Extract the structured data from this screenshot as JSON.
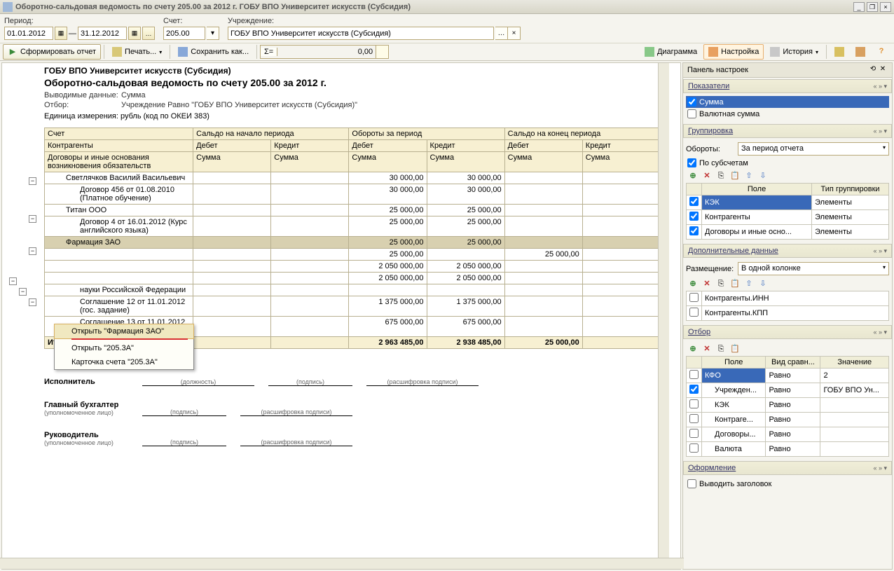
{
  "window_title": "Оборотно-сальдовая ведомость по счету 205.00 за 2012 г. ГОБУ ВПО Университет искусств (Субсидия)",
  "params": {
    "period_label": "Период:",
    "date_from": "01.01.2012",
    "date_to": "31.12.2012",
    "dash": "—",
    "account_label": "Счет:",
    "account": "205.00",
    "org_label": "Учреждение:",
    "org": "ГОБУ ВПО Университет искусств (Субсидия)"
  },
  "toolbar": {
    "run": "Сформировать отчет",
    "print": "Печать...",
    "save": "Сохранить как...",
    "sigma": "Σ=",
    "sigma_val": "0,00",
    "diagram": "Диаграмма",
    "settings": "Настройка",
    "history": "История"
  },
  "report": {
    "org": "ГОБУ ВПО Университет искусств (Субсидия)",
    "title": "Оборотно-сальдовая ведомость по счету 205.00 за 2012 г.",
    "out_lbl": "Выводимые данные:",
    "out_val": "Сумма",
    "filter_lbl": "Отбор:",
    "filter_val": "Учреждение Равно \"ГОБУ ВПО Университет искусств (Субсидия)\"",
    "unit": "Единица измерения: рубль (код по ОКЕИ 383)",
    "h": {
      "acct": "Счет",
      "kontr": "Контрагенты",
      "dogov": "Договоры и иные основания возникновения обязательств",
      "beg": "Сальдо на начало периода",
      "turn": "Обороты за период",
      "end": "Сальдо на конец периода",
      "debit": "Дебет",
      "credit": "Кредит",
      "sum": "Сумма"
    },
    "rows": [
      {
        "t": "agent",
        "lbl": "Светлячков Василий Васильевич",
        "td": "30 000,00",
        "tk": "30 000,00"
      },
      {
        "t": "dogov",
        "lbl": "Договор 456 от 01.08.2010 (Платное обучение)",
        "td": "30 000,00",
        "tk": "30 000,00"
      },
      {
        "t": "agent",
        "lbl": "Титан ООО",
        "td": "25 000,00",
        "tk": "25 000,00"
      },
      {
        "t": "dogov",
        "lbl": "Договор 4 от 16.01.2012 (Курс английского языка)",
        "td": "25 000,00",
        "tk": "25 000,00"
      },
      {
        "t": "agent",
        "lbl": "Фармация ЗАО",
        "td": "25 000,00",
        "tk": "25 000,00",
        "sel": true
      },
      {
        "t": "dogov",
        "lbl": "",
        "td": "25 000,00",
        "ed": "25 000,00"
      },
      {
        "t": "agent",
        "lbl": "",
        "td": "2 050 000,00",
        "tk": "2 050 000,00"
      },
      {
        "t": "dogov",
        "lbl": "",
        "td": "2 050 000,00",
        "tk": "2 050 000,00"
      },
      {
        "t": "dogov",
        "lbl": "науки Российской Федерации",
        "td": "",
        "tk": ""
      },
      {
        "t": "dogov",
        "lbl": "Соглашение 12 от 11.01.2012 (гос. задание)",
        "td": "1 375 000,00",
        "tk": "1 375 000,00"
      },
      {
        "t": "dogov",
        "lbl": "Соглашение 13 от 11.01.2012 (Стипендия)",
        "td": "675 000,00",
        "tk": "675 000,00"
      }
    ],
    "total_lbl": "Итого",
    "total": {
      "td": "2 963 485,00",
      "tk": "2 938 485,00",
      "ed": "25 000,00"
    }
  },
  "ctx": {
    "open1": "Открыть \"Фармация ЗАО\"",
    "open2": "Открыть \"205.3А\"",
    "card": "Карточка счета \"205.3А\""
  },
  "sig": {
    "exec": "Исполнитель",
    "pos": "(должность)",
    "sign": "(подпись)",
    "decode": "(расшифровка подписи)",
    "glav": "Главный бухгалтер",
    "upl": "(уполномоченное лицо)",
    "ruk": "Руководитель"
  },
  "sp": {
    "panel": "Панель настроек",
    "pokaz": "Показатели",
    "summa": "Сумма",
    "valsum": "Валютная сумма",
    "group": "Группировка",
    "oboroty_lbl": "Обороты:",
    "oboroty_val": "За период отчета",
    "posubs": "По субсчетам",
    "field": "Поле",
    "grtype": "Тип группировки",
    "grows": [
      {
        "c": true,
        "f": "КЭК",
        "t": "Элементы",
        "sel": true
      },
      {
        "c": true,
        "f": "Контрагенты",
        "t": "Элементы"
      },
      {
        "c": true,
        "f": "Договоры и иные осно...",
        "t": "Элементы"
      }
    ],
    "dopdata": "Дополнительные данные",
    "razm_lbl": "Размещение:",
    "razm_val": "В одной колонке",
    "dop_rows": [
      "Контрагенты.ИНН",
      "Контрагенты.КПП"
    ],
    "otbor": "Отбор",
    "ot_hdr": {
      "f": "Поле",
      "c": "Вид сравн...",
      "v": "Значение"
    },
    "ot_rows": [
      {
        "c": false,
        "f": "КФО",
        "cmp": "Равно",
        "v": "2",
        "sel": true
      },
      {
        "c": true,
        "f": "Учрежден...",
        "cmp": "Равно",
        "v": "ГОБУ ВПО Ун..."
      },
      {
        "c": false,
        "f": "КЭК",
        "cmp": "Равно",
        "v": ""
      },
      {
        "c": false,
        "f": "Контраге...",
        "cmp": "Равно",
        "v": ""
      },
      {
        "c": false,
        "f": "Договоры...",
        "cmp": "Равно",
        "v": ""
      },
      {
        "c": false,
        "f": "Валюта",
        "cmp": "Равно",
        "v": ""
      }
    ],
    "oform": "Оформление",
    "vyvhead": "Выводить заголовок"
  }
}
